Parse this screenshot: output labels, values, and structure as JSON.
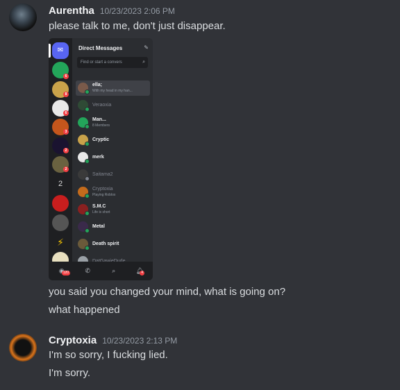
{
  "messages": [
    {
      "author": "Aurentha",
      "timestamp": "10/23/2023 2:06 PM",
      "lines": [
        "please talk to me, don't just disappear.",
        "you said you changed your mind, what is going on?",
        "what happened"
      ]
    },
    {
      "author": "Cryptoxia",
      "timestamp": "10/23/2023 2:13 PM",
      "lines": [
        "I'm so sorry, I fucking lied.",
        "I'm sorry."
      ]
    }
  ],
  "attachment": {
    "header": "Direct Messages",
    "search_placeholder": "Find or start a convers",
    "rail_badges": [
      "6",
      "8",
      "6",
      "3",
      "2",
      "2"
    ],
    "dms": [
      {
        "name": "ella;",
        "sub": "With my head in my han...",
        "color": "#7a5a4a"
      },
      {
        "name": "Veraoxia",
        "sub": "",
        "color": "#2f4a35"
      },
      {
        "name": "Man...",
        "sub": "8 Members",
        "color": "#23a55a"
      },
      {
        "name": "Cryptic",
        "sub": "",
        "color": "#c9a24a"
      },
      {
        "name": "merk",
        "sub": "",
        "color": "#e8e8e8"
      },
      {
        "name": "Saitama2",
        "sub": "",
        "color": "#3a3a3a"
      },
      {
        "name": "Cryptoxia",
        "sub": "Playing Roblox",
        "color": "#c46b1c"
      },
      {
        "name": "S.M.C",
        "sub": "Life is short",
        "color": "#8a2020"
      },
      {
        "name": "Metal",
        "sub": "",
        "color": "#3a2a4a"
      },
      {
        "name": "Death spirit",
        "sub": "",
        "color": "#6a5a3a"
      },
      {
        "name": "DatGawieDude",
        "sub": "",
        "color": "#9aa0a6"
      }
    ],
    "tab_badge_home": "120",
    "tab_badge_notif": "4"
  }
}
